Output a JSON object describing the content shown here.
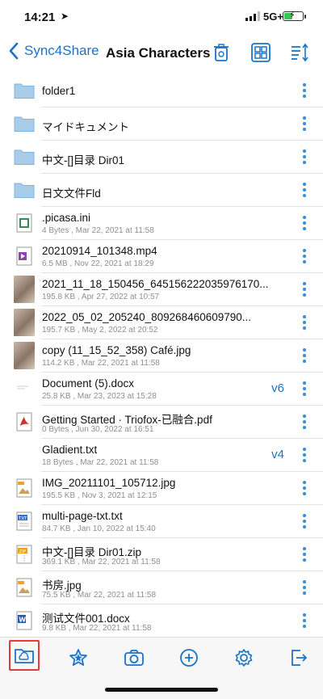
{
  "status": {
    "time": "14:21",
    "network": "5G+"
  },
  "nav": {
    "back_label": "Sync4Share",
    "title": "Asia Characters"
  },
  "items": [
    {
      "type": "folder",
      "name": "folder1"
    },
    {
      "type": "folder",
      "name": "マイドキュメント"
    },
    {
      "type": "folder",
      "name": "中文-[]目录 Dir01"
    },
    {
      "type": "folder",
      "name": "日文文件Fld"
    },
    {
      "type": "file",
      "icon": "generic-file-icon",
      "name": ".picasa.ini",
      "meta": "4 Bytes , Mar 22, 2021 at 11:58"
    },
    {
      "type": "file",
      "icon": "video-file-icon",
      "name": "20210914_101348.mp4",
      "meta": "6.5 MB , Nov 22, 2021 at 18:29"
    },
    {
      "type": "file",
      "icon": "photo-thumbnail",
      "name": "2021_11_18_150456_645156222035976170...",
      "meta": "195.8 KB , Apr 27, 2022 at 10:57"
    },
    {
      "type": "file",
      "icon": "photo-thumbnail",
      "name": "2022_05_02_205240_809268460609790...",
      "meta": "195.7 KB , May 2, 2022 at 20:52"
    },
    {
      "type": "file",
      "icon": "photo-thumbnail",
      "name": "copy (11_15_52_358) Café.jpg",
      "meta": "114.2 KB , Mar 22, 2021 at 11:58"
    },
    {
      "type": "file",
      "icon": "document-thumbnail",
      "name": "Document (5).docx",
      "meta": "25.8 KB , Mar 23, 2023 at 15:28",
      "version": "v6"
    },
    {
      "type": "file",
      "icon": "pdf-file-icon",
      "name": "Getting Started · Triofox-已融合.pdf",
      "meta": "0 Bytes , Jun 30, 2022 at 16:51"
    },
    {
      "type": "file",
      "icon": "text-thumbnail",
      "name": "Gladient.txt",
      "meta": "18 Bytes , Mar 22, 2021 at 11:58",
      "version": "v4"
    },
    {
      "type": "file",
      "icon": "image-file-icon",
      "name": "IMG_20211101_105712.jpg",
      "meta": "195.5 KB , Nov 3, 2021 at 12:15"
    },
    {
      "type": "file",
      "icon": "txt-file-icon",
      "name": "multi-page-txt.txt",
      "meta": "84.7 KB , Jan 10, 2022 at 15:40"
    },
    {
      "type": "file",
      "icon": "zip-file-icon",
      "name": "中文-[]目录 Dir01.zip",
      "meta": "369.1 KB , Mar 22, 2021 at 11:58"
    },
    {
      "type": "file",
      "icon": "image-file-icon",
      "name": "书房.jpg",
      "meta": "75.5 KB , Mar 22, 2021 at 11:58"
    },
    {
      "type": "file",
      "icon": "word-file-icon",
      "name": "测试文件001.docx",
      "meta": "9.8 KB , Mar 22, 2021 at 11:58"
    }
  ],
  "tabs": [
    {
      "icon": "cloud-folder-icon",
      "active": true
    },
    {
      "icon": "star-icon"
    },
    {
      "icon": "camera-icon"
    },
    {
      "icon": "add-circle-icon"
    },
    {
      "icon": "settings-gear-icon"
    },
    {
      "icon": "logout-icon"
    }
  ],
  "colors": {
    "accent": "#1a73c8",
    "folder": "#a9cde9",
    "active_highlight": "#e53935"
  }
}
